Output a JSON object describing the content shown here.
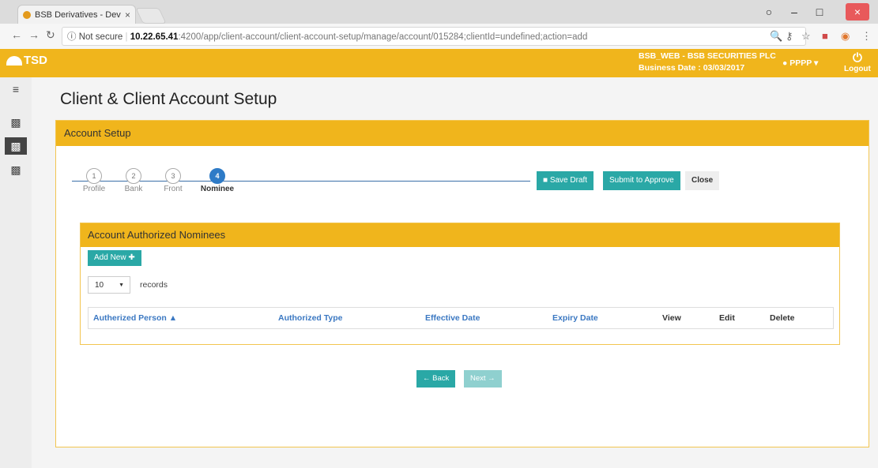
{
  "browser": {
    "tab_title": "BSB Derivatives - Dev",
    "tab_close": "×",
    "url_security": "Not secure",
    "url_host": "10.22.65.41",
    "url_rest": ":4200/app/client-account/client-account-setup/manage/account/015284;clientId=undefined;action=add"
  },
  "app": {
    "logo": "TSD",
    "org_line1": "BSB_WEB - BSB SECURITIES PLC",
    "org_line2": "Business Date : 03/03/2017",
    "user": "PPPP",
    "logout": "Logout"
  },
  "page": {
    "title": "Client & Client Account Setup",
    "panel_title": "Account Setup"
  },
  "steps": [
    {
      "num": "1",
      "label": "Profile"
    },
    {
      "num": "2",
      "label": "Bank"
    },
    {
      "num": "3",
      "label": "Front"
    },
    {
      "num": "4",
      "label": "Nominee"
    }
  ],
  "actions": {
    "save_draft": "Save Draft",
    "submit": "Submit to Approve",
    "close": "Close"
  },
  "nominees": {
    "title": "Account Authorized Nominees",
    "add_new": "Add New",
    "page_size": "10",
    "records_label": "records",
    "columns": [
      "Autherized Person",
      "Authorized Type",
      "Effective Date",
      "Expiry Date",
      "View",
      "Edit",
      "Delete"
    ]
  },
  "pager": {
    "back": "Back",
    "next": "Next"
  },
  "colors": {
    "accent": "#f0b51c",
    "teal": "#2aa8a6",
    "active_step": "#2e7bc7"
  }
}
